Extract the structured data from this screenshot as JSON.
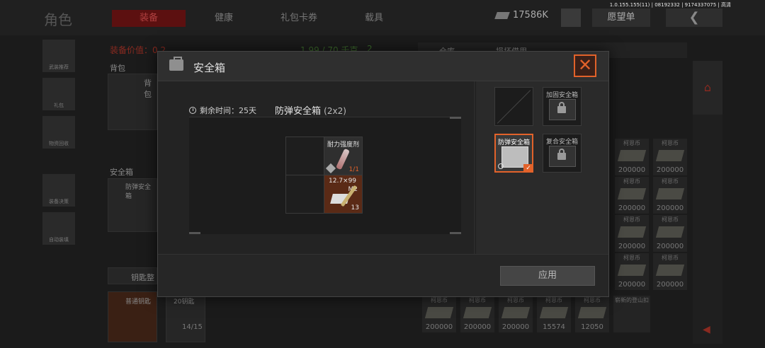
{
  "version": "1.0.155.155(11) | 08192332 | 9174337075 | 高清",
  "header": {
    "title": "角色",
    "tabs": [
      "装备",
      "健康",
      "礼包卡券",
      "载具"
    ],
    "currency": "17586K",
    "wish_label": "愿望单"
  },
  "sidebar": {
    "items": [
      "武装推荐",
      "礼包",
      "物资回收",
      "装备决策",
      "自动装填"
    ]
  },
  "background": {
    "equip_value_label": "装备价值：0.2",
    "weight": "1.99 / 70 千克",
    "weight_extra": "2",
    "backpack": "背包",
    "backpack_inner": "背包",
    "safebox": "安全箱",
    "safebox_card": "防弹安全箱",
    "key_package": "钥匙整",
    "card1": "普通钥匙",
    "card2": "20钥匙",
    "card2_count": "14/15",
    "storage_tabs": [
      "仓库",
      "损坏借用"
    ],
    "cash_name": "柯恩币",
    "cash_amount": "200000",
    "cash_amount_2": "15574",
    "cash_amount_3": "12050",
    "new_item": "崭新的登山扣"
  },
  "modal": {
    "title": "安全箱",
    "remaining_label": "剩余时间：",
    "remaining_value": "25天",
    "case_name": "防弹安全箱",
    "case_size": "(2x2)",
    "items": [
      {
        "name": "耐力强度剂",
        "count": "1/1"
      },
      {
        "name": "12.7×99",
        "sub": "M2",
        "count": "13"
      }
    ],
    "cases": [
      {
        "name": ""
      },
      {
        "name": "加固安全箱"
      },
      {
        "name": "防弹安全箱"
      },
      {
        "name": "复合安全箱"
      }
    ],
    "apply_label": "应用"
  },
  "colors": {
    "accent": "#e2622a",
    "ammo_bg": "#5a2a16"
  }
}
